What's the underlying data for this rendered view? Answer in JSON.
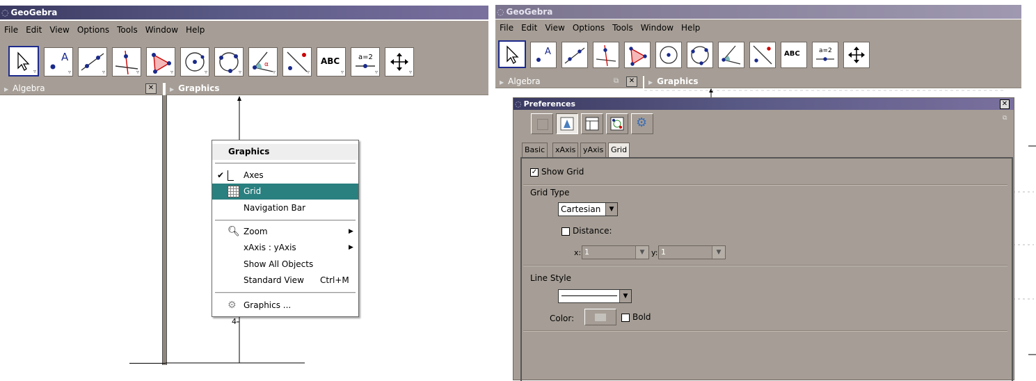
{
  "left": {
    "title": "GeoGebra",
    "menu": [
      "File",
      "Edit",
      "View",
      "Options",
      "Tools",
      "Window",
      "Help"
    ],
    "tools": [
      {
        "icon": "move-arrow-icon"
      },
      {
        "icon": "point-icon",
        "text": "A"
      },
      {
        "icon": "line-icon"
      },
      {
        "icon": "perpendicular-line-icon"
      },
      {
        "icon": "polygon-icon"
      },
      {
        "icon": "circle-center-icon"
      },
      {
        "icon": "circle-three-points-icon"
      },
      {
        "icon": "angle-icon"
      },
      {
        "icon": "reflect-icon"
      },
      {
        "icon": "text-tool-icon",
        "text": "ABC"
      },
      {
        "icon": "slider-icon",
        "text": "a=2"
      },
      {
        "icon": "move-graphics-icon"
      }
    ],
    "algebra_label": "Algebra",
    "graphics_label": "Graphics",
    "axis_tick": "4",
    "context_menu": {
      "title": "Graphics",
      "axes": "Axes",
      "grid": "Grid",
      "navigation_bar": "Navigation Bar",
      "zoom": "Zoom",
      "xaxis_yaxis": "xAxis : yAxis",
      "show_all": "Show All Objects",
      "standard_view": "Standard View",
      "standard_view_shortcut": "Ctrl+M",
      "graphics_settings": "Graphics ..."
    }
  },
  "right": {
    "title": "GeoGebra",
    "menu": [
      "File",
      "Edit",
      "View",
      "Options",
      "Tools",
      "Window",
      "Help"
    ],
    "algebra_label": "Algebra",
    "graphics_label": "Graphics",
    "preferences": {
      "title": "Preferences",
      "close": "X",
      "tabs": [
        "Basic",
        "xAxis",
        "yAxis",
        "Grid"
      ],
      "active_tab": "Grid",
      "show_grid": "Show Grid",
      "grid_type_label": "Grid Type",
      "grid_type_value": "Cartesian",
      "distance_label": "Distance:",
      "x_label": "x:",
      "x_value": "1",
      "y_label": "y:",
      "y_value": "1",
      "line_style_label": "Line Style",
      "color_label": "Color:",
      "bold_label": "Bold"
    }
  },
  "colors": {
    "chrome": "#a69e96",
    "titlebar": "#595985",
    "highlight": "#2a7f7f",
    "selected_tool_border": "#1d2a8c"
  }
}
